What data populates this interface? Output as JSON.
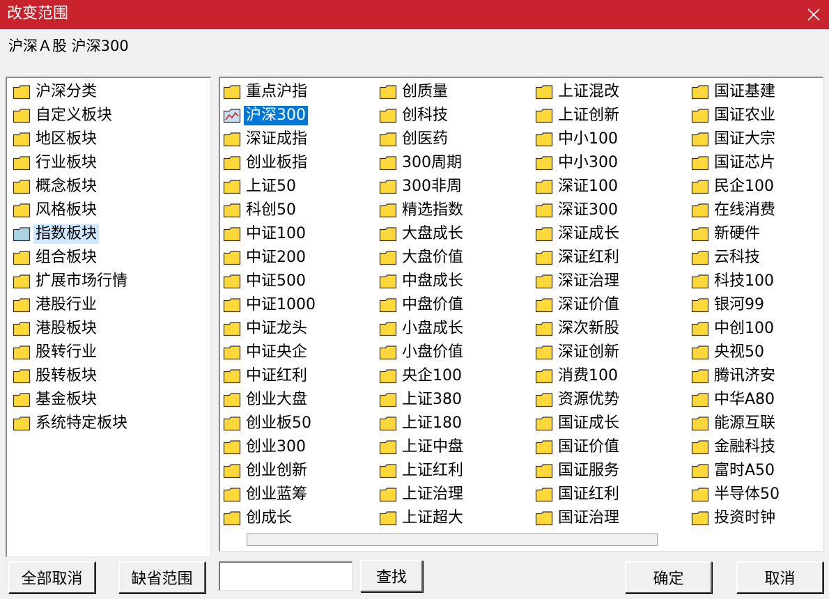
{
  "window": {
    "title": "改变范围",
    "close_glyph": "✕"
  },
  "scope": {
    "label": "沪深Ａ股 沪深300"
  },
  "colors": {
    "titlebar": "#c8232c",
    "folder": "#ffd83a",
    "folder_selected": "#a9d4e0",
    "active_highlight": "#0078d7"
  },
  "left_categories": [
    "沪深分类",
    "自定义板块",
    "地区板块",
    "行业板块",
    "概念板块",
    "风格板块",
    "指数板块",
    "组合板块",
    "扩展市场行情",
    "港股行业",
    "港股板块",
    "股转行业",
    "股转板块",
    "基金板块",
    "系统特定板块"
  ],
  "left_selected_index": 6,
  "index_columns": [
    [
      "重点沪指",
      "沪深300",
      "深证成指",
      "创业板指",
      "上证50",
      "科创50",
      "中证100",
      "中证200",
      "中证500",
      "中证1000",
      "中证龙头",
      "中证央企",
      "中证红利",
      "创业大盘",
      "创业板50",
      "创业300",
      "创业创新",
      "创业蓝筹",
      "创成长"
    ],
    [
      "创质量",
      "创科技",
      "创医药",
      "300周期",
      "300非周",
      "精选指数",
      "大盘成长",
      "大盘价值",
      "中盘成长",
      "中盘价值",
      "小盘成长",
      "小盘价值",
      "央企100",
      "上证380",
      "上证180",
      "上证中盘",
      "上证红利",
      "上证治理",
      "上证超大"
    ],
    [
      "上证混改",
      "上证创新",
      "中小100",
      "中小300",
      "深证100",
      "深证300",
      "深证成长",
      "深证红利",
      "深证治理",
      "深证价值",
      "深次新股",
      "深证创新",
      "消费100",
      "资源优势",
      "国证成长",
      "国证价值",
      "国证服务",
      "国证红利",
      "国证治理"
    ],
    [
      "国证基建",
      "国证农业",
      "国证大宗",
      "国证芯片",
      "民企100",
      "在线消费",
      "新硬件",
      "云科技",
      "科技100",
      "银河99",
      "中创100",
      "央视50",
      "腾讯济安",
      "中华A80",
      "能源互联",
      "金融科技",
      "富时A50",
      "半导体50",
      "投资时钟"
    ]
  ],
  "active_index_item": "沪深300",
  "buttons": {
    "cancel_all": "全部取消",
    "default_range": "缺省范围",
    "search": "查找",
    "ok": "确定",
    "cancel": "取消"
  },
  "search": {
    "value": "",
    "placeholder": ""
  }
}
